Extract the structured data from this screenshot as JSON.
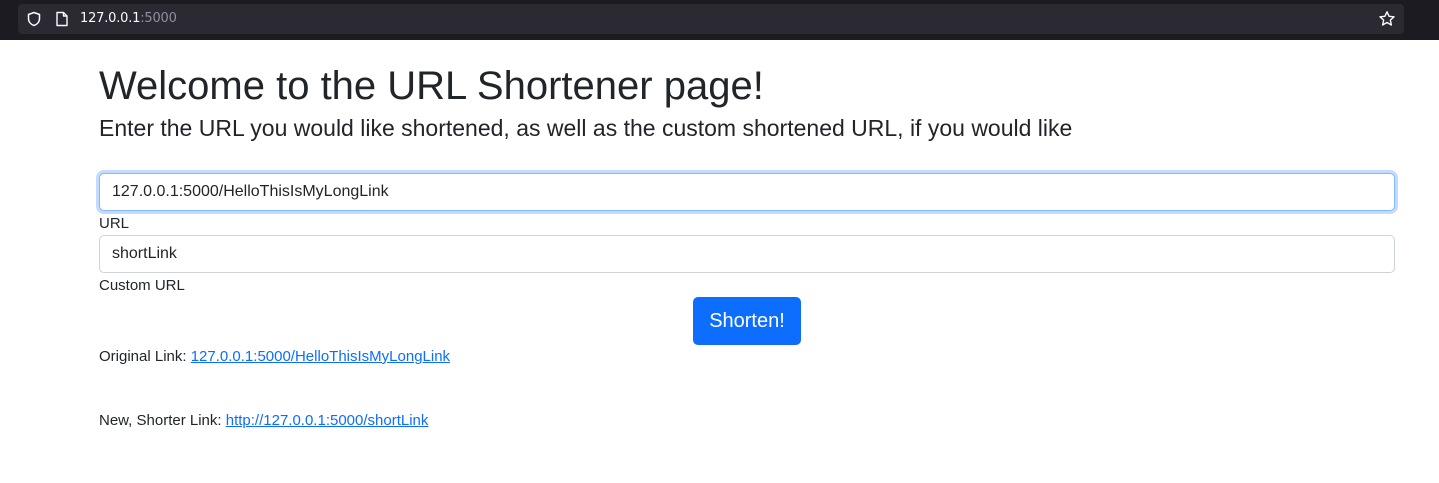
{
  "browser": {
    "url_host": "127.0.0.1",
    "url_port": ":5000",
    "icons": [
      "shield-icon",
      "page-icon",
      "star-icon"
    ]
  },
  "page": {
    "title": "Welcome to the URL Shortener page!",
    "subtitle": "Enter the URL you would like shortened, as well as the custom shortened URL, if you would like"
  },
  "form": {
    "url_value": "127.0.0.1:5000/HelloThisIsMyLongLink",
    "url_label": "URL",
    "custom_value": "shortLink",
    "custom_label": "Custom URL",
    "submit_label": "Shorten!"
  },
  "results": {
    "original_label": "Original Link:",
    "original_link": "127.0.0.1:5000/HelloThisIsMyLongLink",
    "shorter_label": "New, Shorter Link:",
    "shorter_link": "http://127.0.0.1:5000/shortLink"
  },
  "colors": {
    "primary": "#0d6efd",
    "chrome_bg": "#1c1b22",
    "url_field_bg": "#2b2a33"
  }
}
